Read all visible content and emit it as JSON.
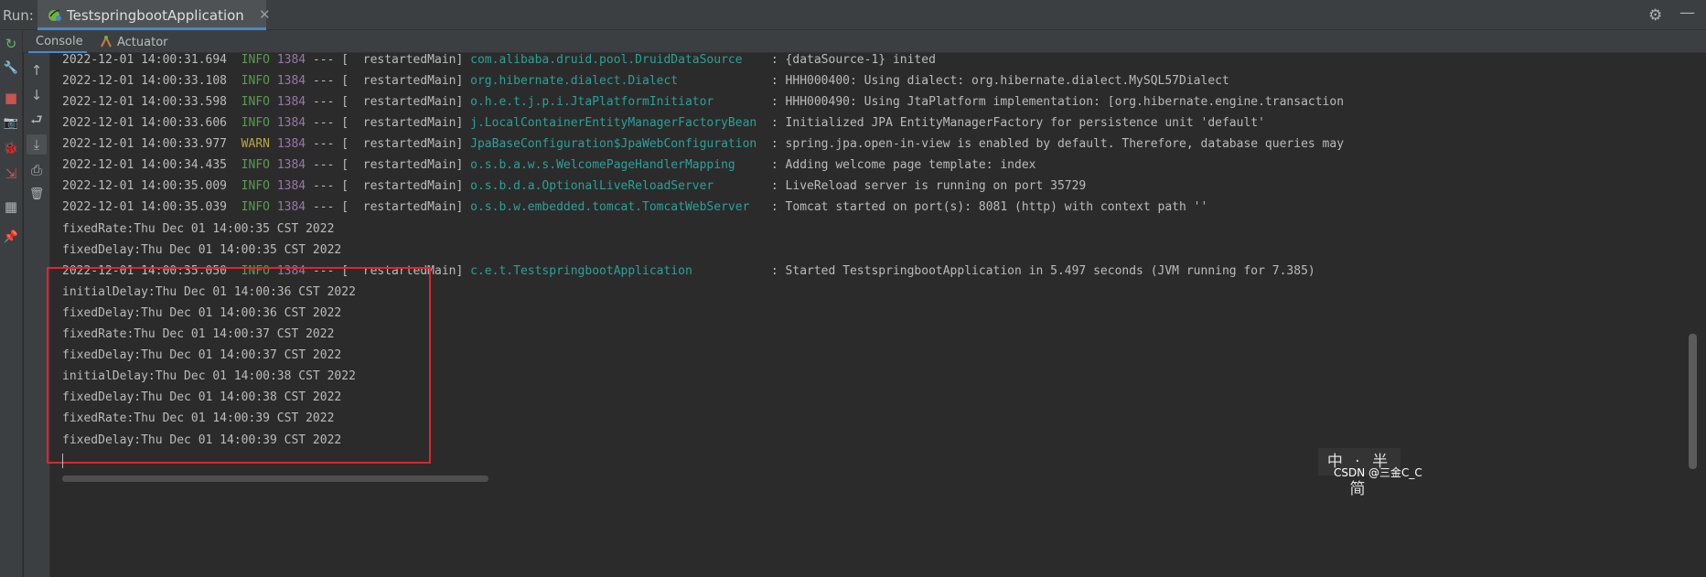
{
  "run_bar": {
    "label": "Run:",
    "tab_title": "TestspringbootApplication",
    "close_glyph": "✕",
    "settings_glyph": "⚙",
    "minimize_glyph": "—"
  },
  "sub_tabs": {
    "console": "Console",
    "actuator": "Actuator"
  },
  "left_toolbar_icons": [
    "rerun-icon",
    "wrench-icon",
    "stop-icon",
    "camera-icon",
    "debug-bug-icon",
    "exit-icon",
    "layout-icon",
    "pin-icon"
  ],
  "console_toolbar_icons": [
    "up-arrow-icon",
    "down-arrow-icon",
    "soft-wrap-icon",
    "scroll-to-end-icon",
    "print-icon",
    "trash-icon"
  ],
  "glyphs": {
    "up": "↑",
    "down": "↓",
    "wrap": "⮐",
    "scroll_end": "⤓",
    "print": "⎙",
    "trash": "🗑",
    "rerun": "↻",
    "wrench": "🔧",
    "stop": "■",
    "camera": "📷",
    "bug": "🐞",
    "exit": "⇲",
    "layout": "▦",
    "pin": "📌"
  },
  "console": {
    "log_lines": [
      {
        "ts": "2022-12-01 14:00:31.694",
        "level": "INFO",
        "pid": "1384",
        "sep": "--- [",
        "thread": "  restartedMain]",
        "logger": "com.alibaba.druid.pool.DruidDataSource   ",
        "msg": ": {dataSource-1} inited"
      },
      {
        "ts": "2022-12-01 14:00:33.108",
        "level": "INFO",
        "pid": "1384",
        "sep": "--- [",
        "thread": "  restartedMain]",
        "logger": "org.hibernate.dialect.Dialect            ",
        "msg": ": HHH000400: Using dialect: org.hibernate.dialect.MySQL57Dialect"
      },
      {
        "ts": "2022-12-01 14:00:33.598",
        "level": "INFO",
        "pid": "1384",
        "sep": "--- [",
        "thread": "  restartedMain]",
        "logger": "o.h.e.t.j.p.i.JtaPlatformInitiator       ",
        "msg": ": HHH000490: Using JtaPlatform implementation: [org.hibernate.engine.transaction"
      },
      {
        "ts": "2022-12-01 14:00:33.606",
        "level": "INFO",
        "pid": "1384",
        "sep": "--- [",
        "thread": "  restartedMain]",
        "logger": "j.LocalContainerEntityManagerFactoryBean ",
        "msg": ": Initialized JPA EntityManagerFactory for persistence unit 'default'"
      },
      {
        "ts": "2022-12-01 14:00:33.977",
        "level": "WARN",
        "pid": "1384",
        "sep": "--- [",
        "thread": "  restartedMain]",
        "logger": "JpaBaseConfiguration$JpaWebConfiguration ",
        "msg": ": spring.jpa.open-in-view is enabled by default. Therefore, database queries may"
      },
      {
        "ts": "2022-12-01 14:00:34.435",
        "level": "INFO",
        "pid": "1384",
        "sep": "--- [",
        "thread": "  restartedMain]",
        "logger": "o.s.b.a.w.s.WelcomePageHandlerMapping    ",
        "msg": ": Adding welcome page template: index"
      },
      {
        "ts": "2022-12-01 14:00:35.009",
        "level": "INFO",
        "pid": "1384",
        "sep": "--- [",
        "thread": "  restartedMain]",
        "logger": "o.s.b.d.a.OptionalLiveReloadServer       ",
        "msg": ": LiveReload server is running on port 35729"
      },
      {
        "ts": "2022-12-01 14:00:35.039",
        "level": "INFO",
        "pid": "1384",
        "sep": "--- [",
        "thread": "  restartedMain]",
        "logger": "o.s.b.w.embedded.tomcat.TomcatWebServer  ",
        "msg": ": Tomcat started on port(s): 8081 (http) with context path ''"
      }
    ],
    "plain_lines_a": [
      "fixedRate:Thu Dec 01 14:00:35 CST 2022",
      "fixedDelay:Thu Dec 01 14:00:35 CST 2022"
    ],
    "started_line": {
      "ts": "2022-12-01 14:00:35.050",
      "level": "INFO",
      "pid": "1384",
      "sep": "--- [",
      "thread": "  restartedMain]",
      "logger": "c.e.t.TestspringbootApplication          ",
      "msg": ": Started TestspringbootApplication in 5.497 seconds (JVM running for 7.385)"
    },
    "plain_lines_b": [
      "initialDelay:Thu Dec 01 14:00:36 CST 2022",
      "fixedDelay:Thu Dec 01 14:00:36 CST 2022",
      "fixedRate:Thu Dec 01 14:00:37 CST 2022",
      "fixedDelay:Thu Dec 01 14:00:37 CST 2022",
      "initialDelay:Thu Dec 01 14:00:38 CST 2022",
      "fixedDelay:Thu Dec 01 14:00:38 CST 2022",
      "fixedRate:Thu Dec 01 14:00:39 CST 2022",
      "fixedDelay:Thu Dec 01 14:00:39 CST 2022"
    ]
  },
  "overlay": {
    "ime_text": "中 · 半 简",
    "watermark": "CSDN @三金C_C"
  },
  "colors": {
    "info": "#5b9a52",
    "warn": "#b7a647",
    "pid": "#9876aa",
    "logger": "#2aa198",
    "highlight_box": "#e3232b",
    "tab_accent": "#4a88c7"
  }
}
